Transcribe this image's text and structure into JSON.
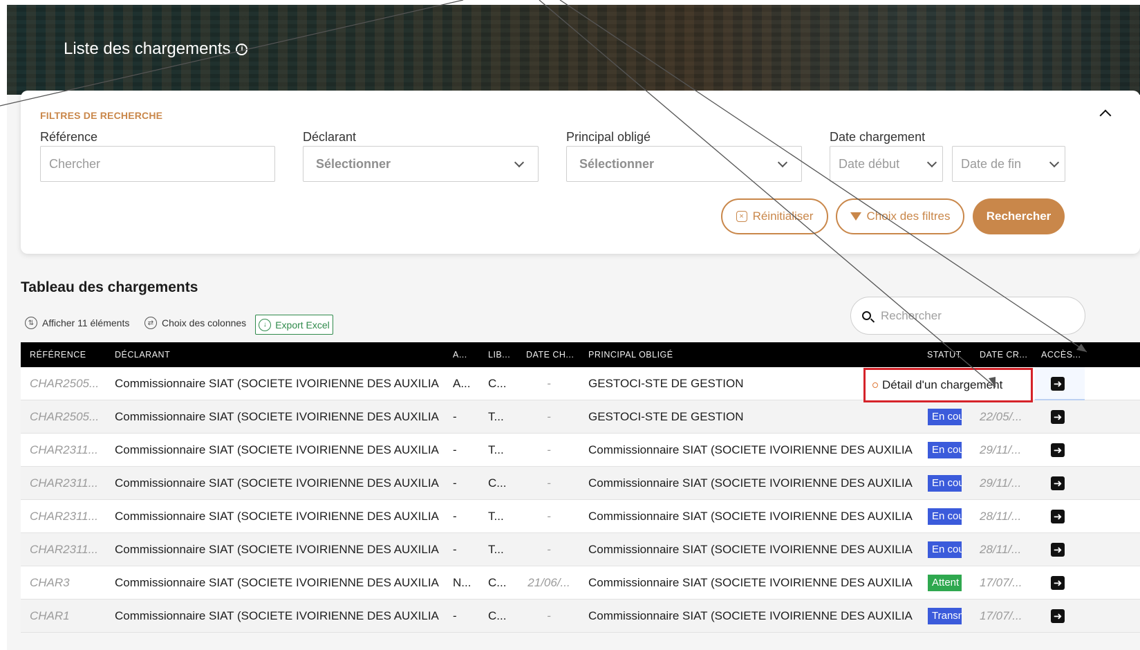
{
  "page": {
    "title": "Liste des chargements"
  },
  "filters": {
    "heading": "FILTRES DE RECHERCHE",
    "reference": {
      "label": "Référence",
      "placeholder": "Chercher"
    },
    "declarant": {
      "label": "Déclarant",
      "value": "Sélectionner"
    },
    "principal": {
      "label": "Principal obligé",
      "value": "Sélectionner"
    },
    "date": {
      "label": "Date chargement",
      "start": "Date début",
      "end": "Date de fin"
    },
    "reset_label": "Réinitialiser",
    "choose_filters_label": "Choix des filtres",
    "search_label": "Rechercher"
  },
  "table": {
    "title": "Tableau des chargements",
    "show_count_label": "Afficher 11 éléments",
    "columns_label": "Choix des colonnes",
    "export_label": "Export Excel",
    "search_placeholder": "Rechercher",
    "headers": [
      "RÉFÉRENCE",
      "DÉCLARANT",
      "A...",
      "LIB...",
      "DATE CH...",
      "PRINCIPAL OBLIGÉ",
      "STATUT",
      "DATE CR...",
      "ACCÈS..."
    ],
    "status_colors": {
      "en_cours": "#3b5bdb",
      "attente": "#2fa84f",
      "transmis": "#3b5bdb"
    },
    "rows": [
      {
        "ref": "CHAR2505...",
        "decl": "Commissionnaire SIAT (SOCIETE IVOIRIENNE DES AUXILIAIR...",
        "a": "A...",
        "lib": "C...",
        "dch": "-",
        "princ": "GESTOCI-STE DE GESTION",
        "statut": "",
        "statut_color": "",
        "dcr": ""
      },
      {
        "ref": "CHAR2505...",
        "decl": "Commissionnaire SIAT (SOCIETE IVOIRIENNE DES AUXILIAIR...",
        "a": "-",
        "lib": "T...",
        "dch": "-",
        "princ": "GESTOCI-STE DE GESTION",
        "statut": "En cou",
        "statut_color": "#3b5bdb",
        "dcr": "22/05/..."
      },
      {
        "ref": "CHAR2311...",
        "decl": "Commissionnaire SIAT (SOCIETE IVOIRIENNE DES AUXILIAIR...",
        "a": "-",
        "lib": "T...",
        "dch": "-",
        "princ": "Commissionnaire SIAT (SOCIETE IVOIRIENNE DES AUXILIAIR...",
        "statut": "En cou",
        "statut_color": "#3b5bdb",
        "dcr": "29/11/..."
      },
      {
        "ref": "CHAR2311...",
        "decl": "Commissionnaire SIAT (SOCIETE IVOIRIENNE DES AUXILIAIR...",
        "a": "-",
        "lib": "C...",
        "dch": "-",
        "princ": "Commissionnaire SIAT (SOCIETE IVOIRIENNE DES AUXILIAIR...",
        "statut": "En cou",
        "statut_color": "#3b5bdb",
        "dcr": "29/11/..."
      },
      {
        "ref": "CHAR2311...",
        "decl": "Commissionnaire SIAT (SOCIETE IVOIRIENNE DES AUXILIAIR...",
        "a": "-",
        "lib": "T...",
        "dch": "-",
        "princ": "Commissionnaire SIAT (SOCIETE IVOIRIENNE DES AUXILIAIR...",
        "statut": "En cou",
        "statut_color": "#3b5bdb",
        "dcr": "28/11/..."
      },
      {
        "ref": "CHAR2311...",
        "decl": "Commissionnaire SIAT (SOCIETE IVOIRIENNE DES AUXILIAIR...",
        "a": "-",
        "lib": "T...",
        "dch": "-",
        "princ": "Commissionnaire SIAT (SOCIETE IVOIRIENNE DES AUXILIAIR...",
        "statut": "En cou",
        "statut_color": "#3b5bdb",
        "dcr": "28/11/..."
      },
      {
        "ref": "CHAR3",
        "decl": "Commissionnaire SIAT (SOCIETE IVOIRIENNE DES AUXILIAIR...",
        "a": "N...",
        "lib": "C...",
        "dch": "21/06/...",
        "princ": "Commissionnaire SIAT (SOCIETE IVOIRIENNE DES AUXILIAIR...",
        "statut": "Attent",
        "statut_color": "#2fa84f",
        "dcr": "17/07/..."
      },
      {
        "ref": "CHAR1",
        "decl": "Commissionnaire SIAT (SOCIETE IVOIRIENNE DES AUXILIAIR...",
        "a": "-",
        "lib": "C...",
        "dch": "-",
        "princ": "Commissionnaire SIAT (SOCIETE IVOIRIENNE DES AUXILIAIR...",
        "statut": "Transm",
        "statut_color": "#3b5bdb",
        "dcr": "17/07/..."
      }
    ],
    "tooltip": "Détail d'un chargement"
  },
  "icons": {
    "info": "info-circle-icon",
    "collapse": "chevron-up-icon",
    "access": "arrow-right-box-icon",
    "search": "search-icon"
  }
}
